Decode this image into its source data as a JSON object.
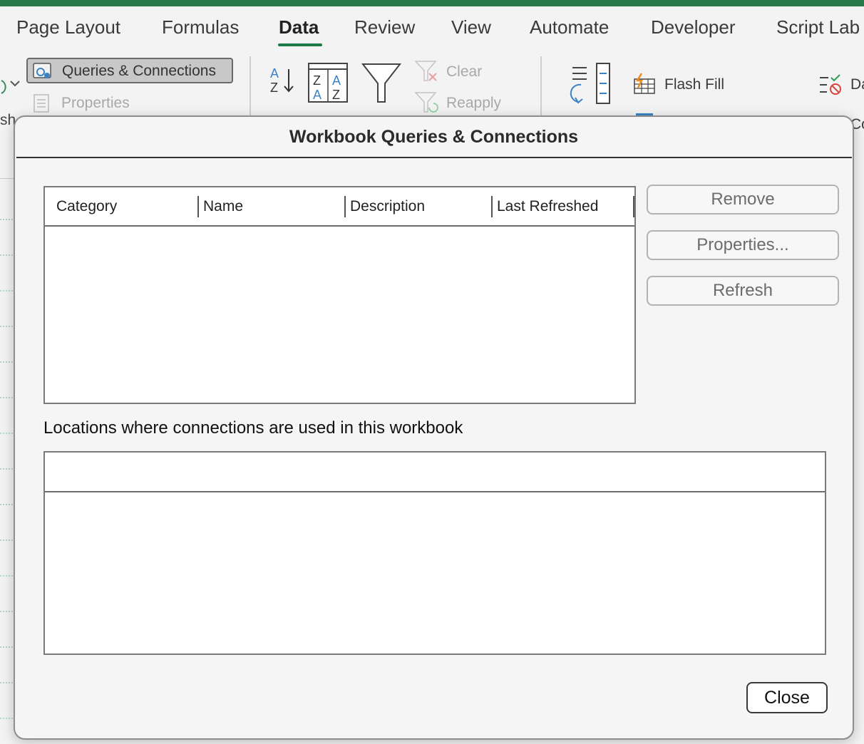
{
  "ribbon_tabs": [
    {
      "label": "Page Layout",
      "active": false
    },
    {
      "label": "Formulas",
      "active": false
    },
    {
      "label": "Data",
      "active": true
    },
    {
      "label": "Review",
      "active": false
    },
    {
      "label": "View",
      "active": false
    },
    {
      "label": "Automate",
      "active": false
    },
    {
      "label": "Developer",
      "active": false
    },
    {
      "label": "Script Lab",
      "active": false
    }
  ],
  "ribbon": {
    "queries_connections": "Queries & Connections",
    "properties": "Properties",
    "refresh_partial": "sh",
    "clear": "Clear",
    "reapply": "Reapply",
    "flash_fill": "Flash Fill",
    "da_partial": "Da",
    "co_partial": "Co"
  },
  "dialog": {
    "title": "Workbook Queries & Connections",
    "columns": [
      "Category",
      "Name",
      "Description",
      "Last Refreshed"
    ],
    "buttons": {
      "remove": "Remove",
      "properties": "Properties...",
      "refresh": "Refresh",
      "close": "Close"
    },
    "locations_label": "Locations where connections are used in this workbook"
  },
  "colors": {
    "accent_green": "#1e7a45",
    "title_bar_green": "#2b7a4b"
  }
}
